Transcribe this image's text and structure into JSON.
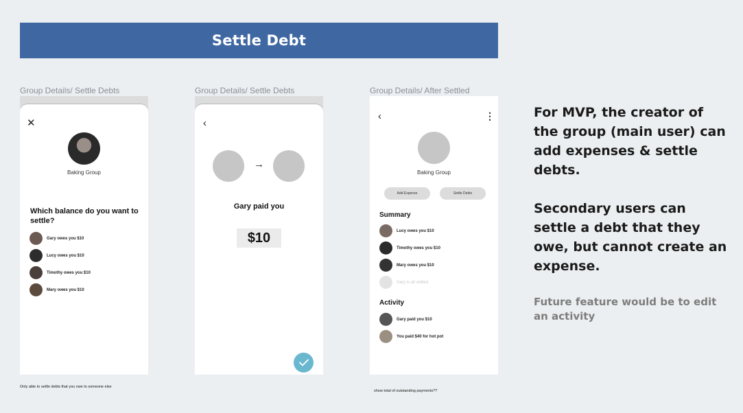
{
  "banner": {
    "title": "Settle Debt"
  },
  "frame1": {
    "label": "Group Details/ Settle Debts",
    "group_name": "Baking Group",
    "question": "Which balance do you want to settle?",
    "rows": [
      {
        "text": "Gary owes you $10",
        "avatar_color": "#6b5a52"
      },
      {
        "text": "Lucy owes you $10",
        "avatar_color": "#2d2d2d"
      },
      {
        "text": "Timothy owes you $10",
        "avatar_color": "#4a3f3a"
      },
      {
        "text": "Mary owes you $10",
        "avatar_color": "#5c4a3e"
      }
    ],
    "note": "Only able to settle debts that you owe to someone else"
  },
  "frame2": {
    "label": "Group Details/ Settle Debts",
    "title": "Gary paid you",
    "amount": "$10"
  },
  "frame3": {
    "label": "Group Details/ After Settled",
    "group_name": "Baking Group",
    "buttons": {
      "add_expense": "Add Expense",
      "settle_debts": "Settle Debts"
    },
    "summary_title": "Summary",
    "summary": [
      {
        "text": "Lucy owes you $10",
        "avatar_color": "#7a6a64",
        "muted": false
      },
      {
        "text": "Timothy owes you $10",
        "avatar_color": "#2b2b2b",
        "muted": false
      },
      {
        "text": "Mary owes you $10",
        "avatar_color": "#333333",
        "muted": false
      },
      {
        "text": "Gary is all settled",
        "avatar_color": "#dedede",
        "muted": true
      }
    ],
    "activity_title": "Activity",
    "activity": [
      {
        "text": "Gary paid you $10",
        "avatar_color": "#555555"
      },
      {
        "text": "You paid $40 for hot pot",
        "avatar_color": "#9a8f80"
      }
    ],
    "note": "show total of outstanding payments??"
  },
  "side": {
    "p1": "For MVP, the creator of the group (main user) can add expenses & settle debts.",
    "p2": "Secondary users can settle a debt that they owe, but cannot create an expense.",
    "p3": "Future feature would be to edit an activity"
  },
  "colors": {
    "banner": "#3f68a3",
    "check": "#6ab7d0",
    "placeholder": "#c6c6c6"
  },
  "icons": {
    "close": "close-icon",
    "back": "chevron-left-icon",
    "more": "more-vertical-icon",
    "arrow": "arrow-right-icon",
    "check": "check-icon"
  }
}
